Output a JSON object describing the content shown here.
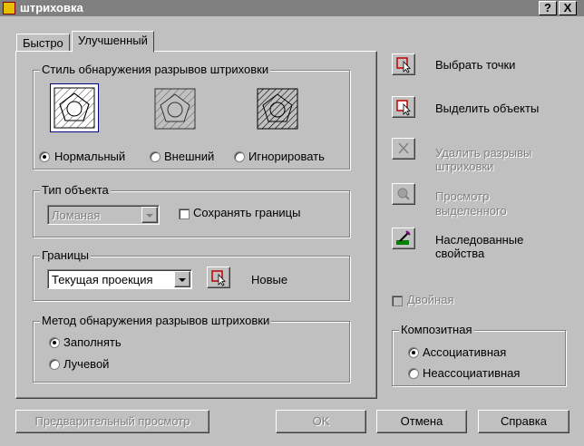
{
  "window": {
    "title": "штриховка",
    "help_btn": "?",
    "close_btn": "X"
  },
  "tabs": [
    "Быстро",
    "Улучшенный"
  ],
  "island_group": {
    "title": "Стиль обнаружения разрывов штриховки",
    "options": [
      {
        "label": "Нормальный",
        "selected": true
      },
      {
        "label": "Внешний",
        "selected": false
      },
      {
        "label": "Игнорировать",
        "selected": false
      }
    ]
  },
  "object_type": {
    "title": "Тип объекта",
    "select_value": "Ломаная",
    "retain_label": "Сохранять границы"
  },
  "boundary": {
    "title": "Границы",
    "select_value": "Текущая проекция",
    "new_label": "Новые"
  },
  "detection": {
    "title": "Метод обнаружения разрывов штриховки",
    "options": [
      {
        "label": "Заполнять",
        "selected": true
      },
      {
        "label": "Лучевой",
        "selected": false
      }
    ]
  },
  "actions": {
    "pick_points": "Выбрать точки",
    "select_objects": "Выделить объекты",
    "remove_islands_1": "Удалить разрывы",
    "remove_islands_2": "штриховки",
    "view_selection_1": "Просмотр",
    "view_selection_2": "выделенного",
    "inherit_1": "Наследованные",
    "inherit_2": "свойства"
  },
  "double_label": "Двойная",
  "composition": {
    "title": "Композитная",
    "options": [
      {
        "label": "Ассоциативная",
        "selected": true
      },
      {
        "label": "Неассоциативная",
        "selected": false
      }
    ]
  },
  "buttons": {
    "preview": "Предварительный просмотр",
    "ok": "OK",
    "cancel": "Отмена",
    "help": "Справка"
  }
}
